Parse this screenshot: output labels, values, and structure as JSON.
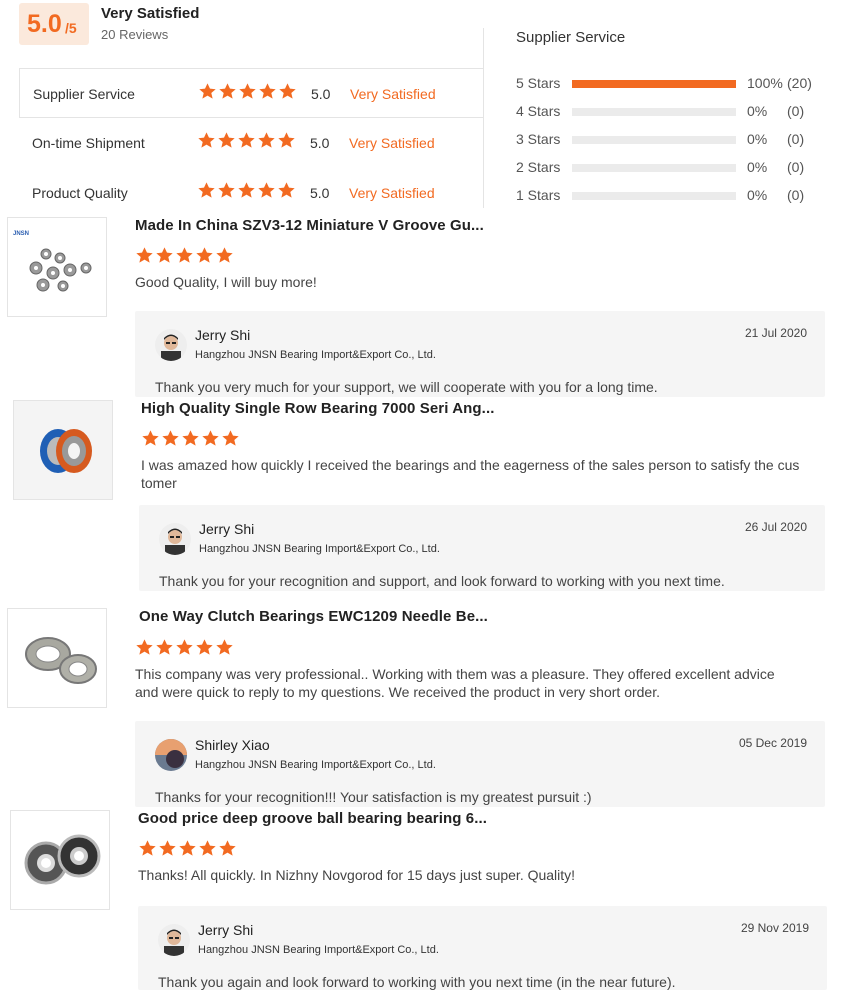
{
  "summary": {
    "score": "5.0",
    "score_max": "/5",
    "title": "Very Satisfied",
    "reviews": "20 Reviews"
  },
  "ratings": [
    {
      "label": "Supplier Service",
      "score": "5.0",
      "text": "Very Satisfied",
      "stars": 5
    },
    {
      "label": "On-time Shipment",
      "score": "5.0",
      "text": "Very Satisfied",
      "stars": 5
    },
    {
      "label": "Product Quality",
      "score": "5.0",
      "text": "Very Satisfied",
      "stars": 5
    }
  ],
  "distribution": {
    "title": "Supplier Service",
    "rows": [
      {
        "label": "5 Stars",
        "fraction": 1.0,
        "pct": "100%",
        "count": "(20)"
      },
      {
        "label": "4 Stars",
        "fraction": 0.0,
        "pct": "0%",
        "count": "(0)"
      },
      {
        "label": "3 Stars",
        "fraction": 0.0,
        "pct": "0%",
        "count": "(0)"
      },
      {
        "label": "2 Stars",
        "fraction": 0.0,
        "pct": "0%",
        "count": "(0)"
      },
      {
        "label": "1 Stars",
        "fraction": 0.0,
        "pct": "0%",
        "count": "(0)"
      }
    ]
  },
  "reviews": [
    {
      "title": "Made In China SZV3-12 Miniature V Groove Gu...",
      "stars": 5,
      "body": "Good Quality, I will buy more!",
      "reply": {
        "name": "Jerry Shi",
        "company": "Hangzhou JNSN Bearing Import&Export Co., Ltd.",
        "date": "21 Jul 2020",
        "message": "Thank you very much for your support, we will cooperate with you for a long time."
      }
    },
    {
      "title": "High Quality Single Row Bearing 7000 Seri Ang...",
      "stars": 5,
      "body": "I was amazed how quickly I received the bearings and the eagerness of the sales person to satisfy the customer",
      "reply": {
        "name": "Jerry Shi",
        "company": "Hangzhou JNSN Bearing Import&Export Co., Ltd.",
        "date": "26 Jul 2020",
        "message": "Thank you for your recognition and support, and look forward to working with you next time."
      }
    },
    {
      "title": "One Way Clutch Bearings EWC1209 Needle Be...",
      "stars": 5,
      "body": "This company was very professional.. Working with them was a pleasure. They offered excellent advice and were quick to reply to my questions.  We received the product in very short order.",
      "reply": {
        "name": "Shirley Xiao",
        "company": "Hangzhou JNSN Bearing Import&Export Co., Ltd.",
        "date": "05 Dec 2019",
        "message": "Thanks for your recognition!!!  Your satisfaction is my greatest pursuit :)"
      }
    },
    {
      "title": "Good price deep groove ball bearing bearing 6...",
      "stars": 5,
      "body": "Thanks! All quickly. In Nizhny Novgorod for 15 days just super. Quality!",
      "reply": {
        "name": "Jerry Shi",
        "company": "Hangzhou JNSN Bearing Import&Export Co., Ltd.",
        "date": "29 Nov 2019",
        "message": "Thank you again and look forward to working with you next time (in the near future)."
      }
    }
  ],
  "colors": {
    "accent": "#f26a21",
    "star": "#f26a21",
    "reply_bg": "#f5f5f5"
  }
}
